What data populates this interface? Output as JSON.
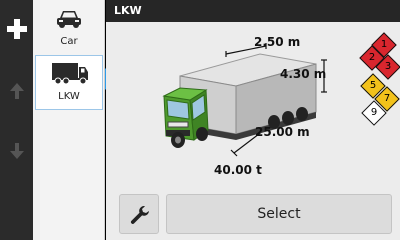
{
  "header": {
    "title": "LKW"
  },
  "vehicles": [
    {
      "label": "Car",
      "icon": "car-icon",
      "selected": false
    },
    {
      "label": "LKW",
      "icon": "truck-icon",
      "selected": true
    }
  ],
  "dimensions": {
    "width": "2.50 m",
    "height": "4.30 m",
    "length": "25.00 m",
    "weight": "40.00  t"
  },
  "hazard_classes": [
    {
      "label": "1",
      "color": "#d9262e"
    },
    {
      "label": "2",
      "color": "#d9262e"
    },
    {
      "label": "3",
      "color": "#d9262e"
    },
    {
      "label": "5",
      "color": "#f2c21b"
    },
    {
      "label": "7",
      "color": "#f2c21b"
    },
    {
      "label": "9",
      "color": "#ffffff"
    }
  ],
  "actions": {
    "select_label": "Select",
    "settings_icon": "wrench-icon"
  },
  "colors": {
    "accent": "#2d9be8",
    "header_bg": "#262626",
    "truck_cab": "#5fb33a"
  }
}
